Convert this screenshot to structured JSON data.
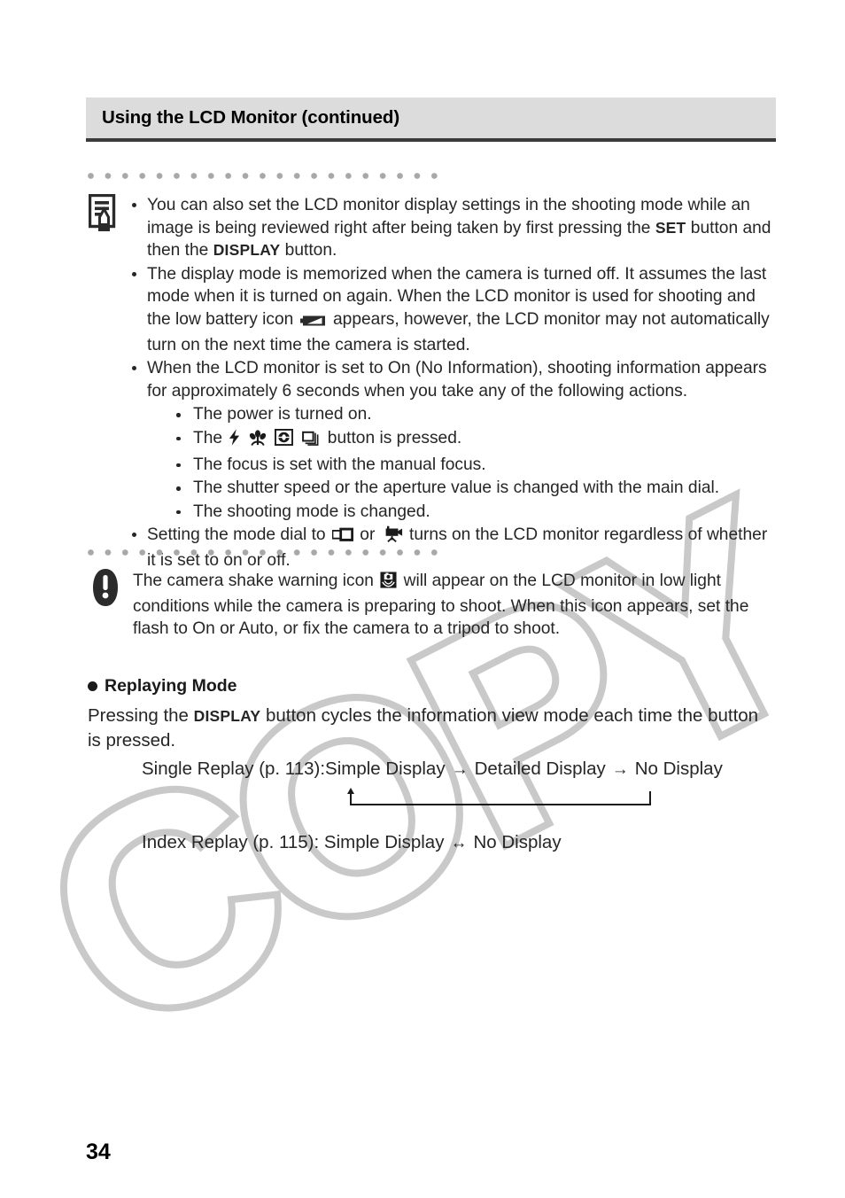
{
  "header": {
    "title": "Using the LCD Monitor (continued)"
  },
  "note": {
    "icon": "note-pencil-icon",
    "bullets": [
      {
        "parts": [
          {
            "t": "text",
            "v": "You can also set the LCD monitor display settings in the shooting mode while an image is being reviewed right after being taken by first pressing the "
          },
          {
            "t": "kbd",
            "v": "SET"
          },
          {
            "t": "text",
            "v": " button and then the "
          },
          {
            "t": "kbd",
            "v": "DISPLAY"
          },
          {
            "t": "text",
            "v": " button."
          }
        ]
      },
      {
        "parts": [
          {
            "t": "text",
            "v": "The display mode is memorized when the camera is turned off. It assumes the last mode when it is turned on again. When the LCD monitor is used for shooting and the low battery icon "
          },
          {
            "t": "icon",
            "v": "low-battery-icon"
          },
          {
            "t": "text",
            "v": " appears, however, the LCD monitor may not automatically turn on the next time the camera is started."
          }
        ]
      },
      {
        "parts": [
          {
            "t": "text",
            "v": "When the LCD monitor is set to On (No Information), shooting information appears for approximately 6 seconds when you take any of the following actions."
          }
        ],
        "sub": [
          {
            "parts": [
              {
                "t": "text",
                "v": "The power is turned on."
              }
            ]
          },
          {
            "parts": [
              {
                "t": "text",
                "v": "The "
              },
              {
                "t": "icon",
                "v": "flash-icon"
              },
              {
                "t": "icon",
                "v": "macro-flower-icon"
              },
              {
                "t": "icon",
                "v": "red-eye-icon"
              },
              {
                "t": "icon",
                "v": "drive-mode-icon"
              },
              {
                "t": "text",
                "v": " button is pressed."
              }
            ]
          },
          {
            "parts": [
              {
                "t": "text",
                "v": "The focus is set with the manual focus."
              }
            ]
          },
          {
            "parts": [
              {
                "t": "text",
                "v": "The shutter speed or the aperture value is changed with the main dial."
              }
            ]
          },
          {
            "parts": [
              {
                "t": "text",
                "v": "The shooting mode is changed."
              }
            ]
          }
        ]
      },
      {
        "parts": [
          {
            "t": "text",
            "v": "Setting the mode dial to "
          },
          {
            "t": "icon",
            "v": "stitch-assist-icon"
          },
          {
            "t": "text",
            "v": " or "
          },
          {
            "t": "icon",
            "v": "movie-camera-icon"
          },
          {
            "t": "text",
            "v": " turns on the LCD monitor regardless of whether it is set to on or off."
          }
        ]
      }
    ]
  },
  "warning": {
    "icon": "exclamation-warning-icon",
    "parts": [
      {
        "t": "text",
        "v": "The camera shake warning icon "
      },
      {
        "t": "icon",
        "v": "camera-shake-icon"
      },
      {
        "t": "text",
        "v": " will appear on the LCD monitor in low light conditions while the camera is preparing to shoot. When this icon appears, set the flash to On or Auto, or fix the camera to a tripod to shoot."
      }
    ]
  },
  "replaying": {
    "heading": "Replaying Mode",
    "intro_parts": [
      {
        "t": "text",
        "v": "Pressing the "
      },
      {
        "t": "kbd",
        "v": "DISPLAY"
      },
      {
        "t": "text",
        "v": " button cycles the information view mode each time the button is pressed."
      }
    ],
    "flows": [
      {
        "label": "Single Replay (p. 113):",
        "steps": [
          "Simple Display",
          "Detailed Display",
          "No Display"
        ],
        "arrow": "→",
        "loopback": true
      },
      {
        "label": "Index Replay (p. 115):",
        "steps": [
          "Simple Display",
          "No Display"
        ],
        "arrow": "↔",
        "loopback": false
      }
    ]
  },
  "watermark": {
    "text": "COPY",
    "color": "#c9c9c9"
  },
  "footer": {
    "page_number": "34"
  }
}
